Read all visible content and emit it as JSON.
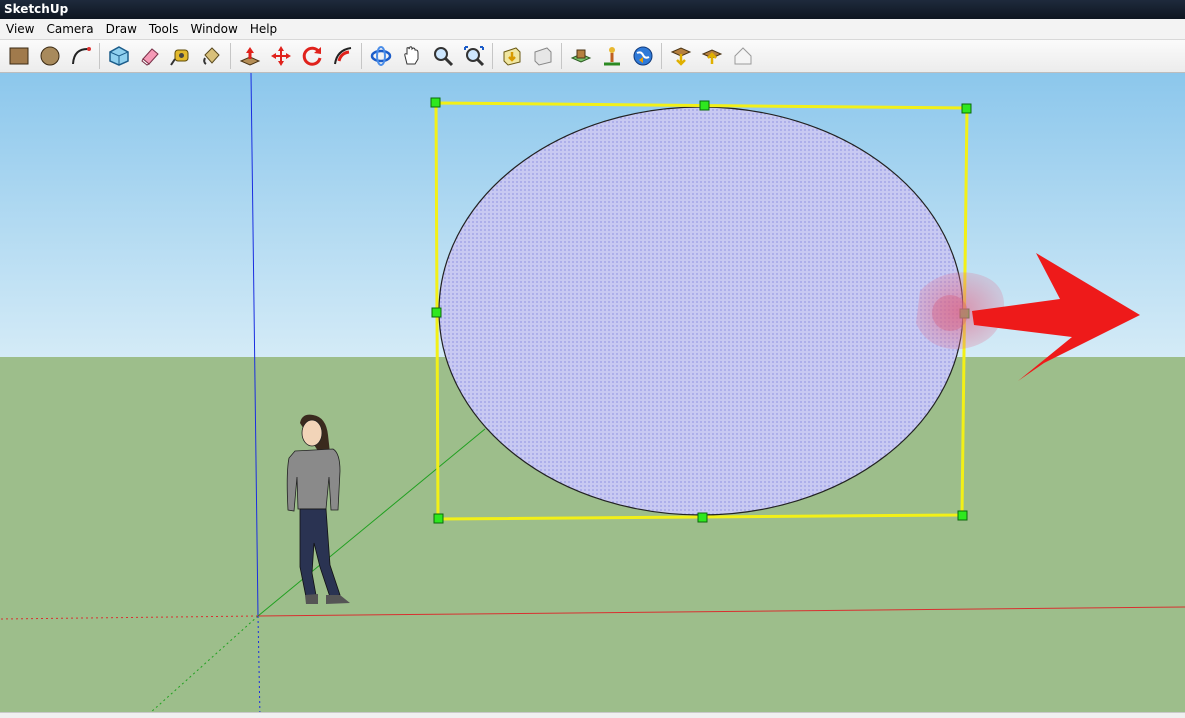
{
  "window": {
    "title": "SketchUp"
  },
  "menu": [
    "View",
    "Camera",
    "Draw",
    "Tools",
    "Window",
    "Help"
  ],
  "toolbar": [
    "rectangle-tool-icon",
    "circle-tool-icon",
    "arc-tool-icon",
    "sep",
    "make-component-icon",
    "eraser-icon",
    "tape-measure-icon",
    "paint-bucket-icon",
    "sep",
    "push-pull-icon",
    "move-icon",
    "rotate-icon",
    "follow-me-icon",
    "sep",
    "orbit-icon",
    "pan-icon",
    "zoom-icon",
    "zoom-extents-icon",
    "sep",
    "get-models-icon",
    "share-model-icon",
    "sep",
    "add-location-icon",
    "toggle-terrain-icon",
    "preview-google-earth-icon",
    "sep",
    "get-models-2-icon",
    "share-component-icon",
    "upload-building-icon"
  ],
  "scene": {
    "sky_color": "#a7d3ee",
    "ground_color": "#9dbe8b",
    "ellipse_fill": "#c8c9f2",
    "selection_color": "#f2f018",
    "grip_color": "#2ee81f",
    "arrow_color": "#ee1a1a"
  }
}
